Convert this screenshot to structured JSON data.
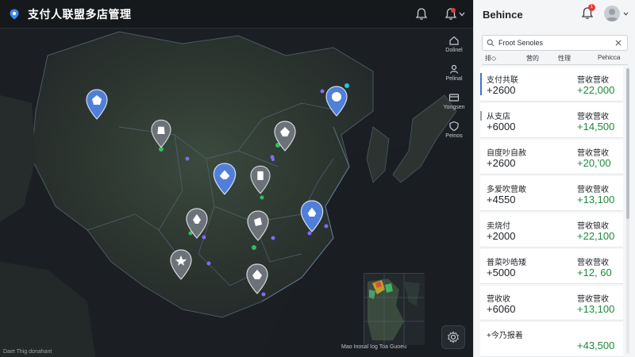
{
  "header": {
    "title": "支付人联盟多店管理",
    "logo_icon": "location-pin-icon",
    "bell_icon": "bell-icon",
    "alert_bell_icon": "bell-alert-icon",
    "dropdown_icon": "chevron-down-icon"
  },
  "map": {
    "rail": [
      {
        "label": "Dolinel",
        "icon": "home-icon"
      },
      {
        "label": "Pelinal",
        "icon": "person-icon"
      },
      {
        "label": "Yongsen",
        "icon": "card-icon"
      },
      {
        "label": "Peinos",
        "icon": "shield-icon"
      }
    ],
    "minimap_caption": "Mao Inosal Iog Toa Guoeu",
    "footer": "Daet Thig donahant",
    "settings_icon": "settings-icon"
  },
  "panel": {
    "brand": "Behince",
    "notification_count": "1",
    "search": {
      "value": "Froot Senoles",
      "icon": "search-icon",
      "clear_icon": "close-icon"
    },
    "tabs": [
      "排◇",
      "营的",
      "性理",
      "Pehicca"
    ],
    "stores": [
      {
        "name": "支付共联",
        "count": "+2600",
        "revenue_label": "营收营收",
        "revenue": "+22,000",
        "indicator": "active"
      },
      {
        "name": "从支店",
        "count": "+6000",
        "revenue_label": "营收营收",
        "revenue": "+14,500",
        "indicator": "muted"
      },
      {
        "name": "自度吵自赦",
        "count": "+2600",
        "revenue_label": "营收营收",
        "revenue": "+20,'00",
        "indicator": "none"
      },
      {
        "name": "多爱吹营敢",
        "count": "+4550",
        "revenue_label": "营收营收",
        "revenue": "+13,100",
        "indicator": "none"
      },
      {
        "name": "卖烧付",
        "count": "+2000",
        "revenue_label": "营收锒收",
        "revenue": "+22,100",
        "indicator": "none"
      },
      {
        "name": "普菜吵皓矮",
        "count": "+5000",
        "revenue_label": "营收营收",
        "revenue": "+12, 60",
        "indicator": "none"
      },
      {
        "name": "营收收",
        "count": "+6060",
        "revenue_label": "营收营收",
        "revenue": "+13,100",
        "indicator": "none"
      },
      {
        "name": "+今乃报着",
        "count": "",
        "revenue_label": "",
        "revenue": "+43,500",
        "indicator": "none"
      }
    ]
  },
  "colors": {
    "accent": "#3f73d6",
    "positive": "#1f8a3c",
    "alert": "#e23b3b",
    "map_bg": "#1c2024"
  }
}
